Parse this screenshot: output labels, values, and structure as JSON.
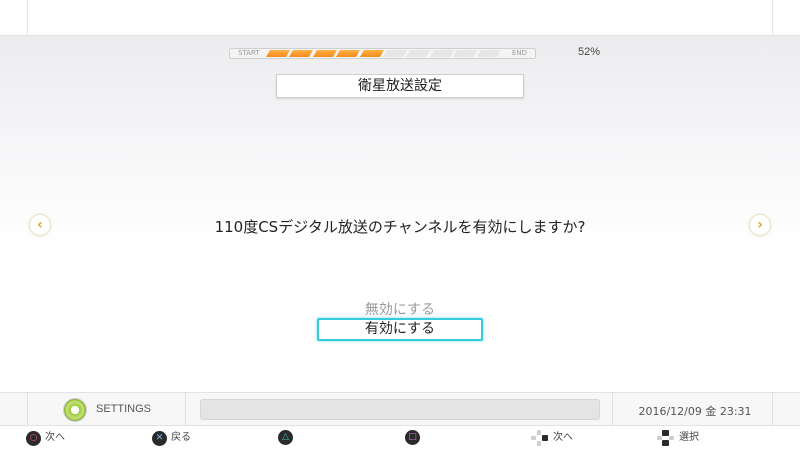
{
  "progress": {
    "start_label": "START",
    "end_label": "END",
    "percent_text": "52%",
    "percent_value": 52,
    "segments_total": 10,
    "segments_filled": 5
  },
  "title": "衛星放送設定",
  "question": "110度CSデジタル放送のチャンネルを有効にしますか?",
  "options": {
    "disabled": "無効にする",
    "selected": "有効にする"
  },
  "nav": {
    "left_icon": "chevron-left-icon",
    "right_icon": "chevron-right-icon"
  },
  "status_bar": {
    "app_label": "SETTINGS",
    "datetime": "2016/12/09 金 23:31"
  },
  "guide": {
    "circle": "次へ",
    "cross": "戻る",
    "dpad_right": "次へ",
    "dpad_updown": "選択"
  },
  "colors": {
    "progress_fill": "#f28a1a",
    "focus_border": "#33ccdd",
    "arrow": "#e0a020",
    "circle_symbol": "#e85a8a",
    "cross_symbol": "#8ab4f0",
    "triangle_symbol": "#3cc8b4",
    "square_symbol": "#e070d0"
  }
}
